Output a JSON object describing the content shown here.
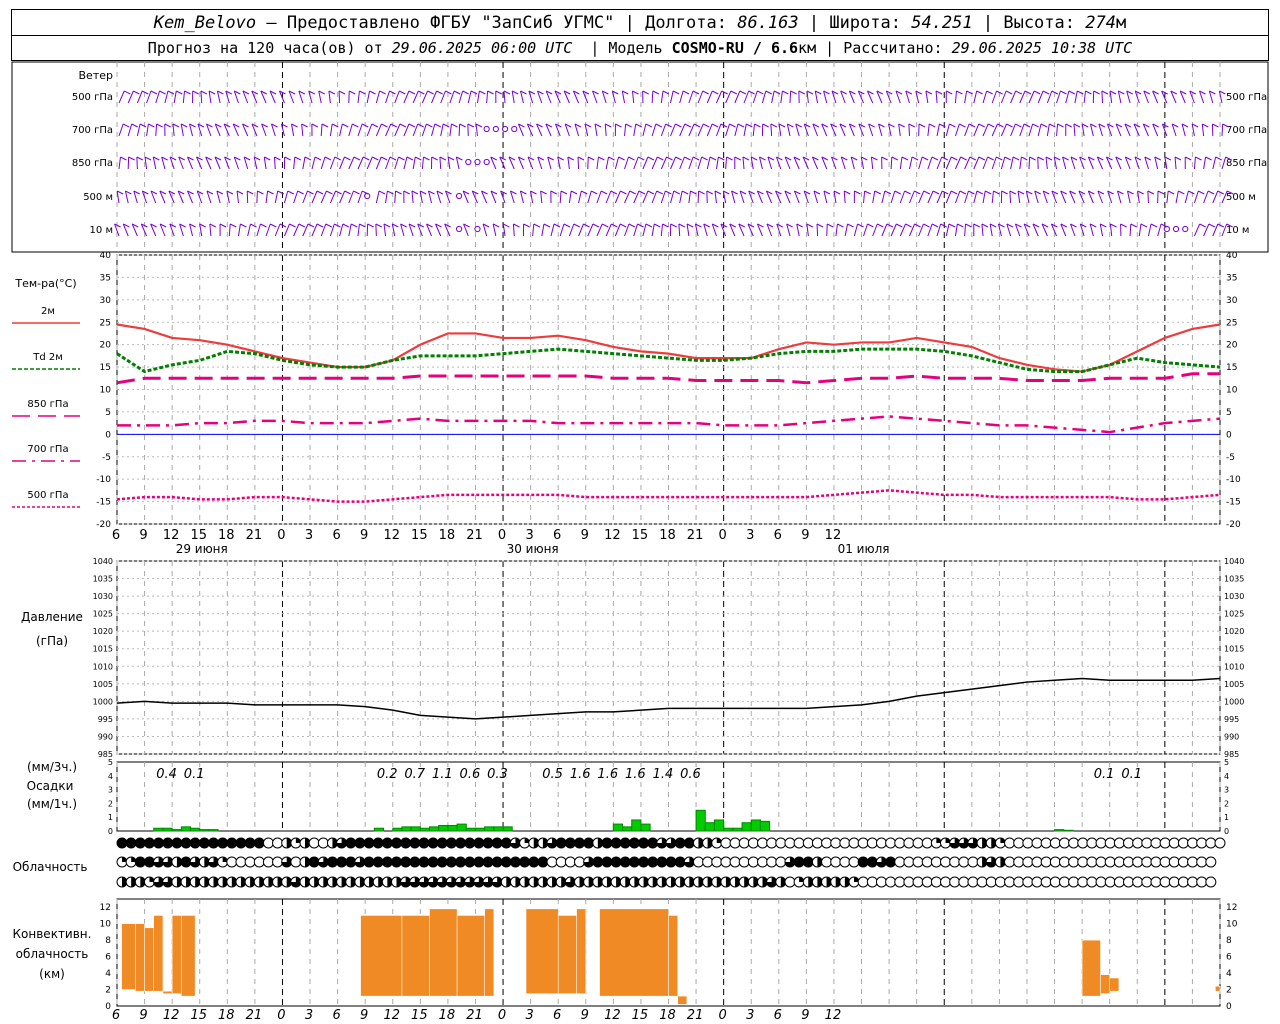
{
  "header": {
    "station": "Kem_Belovo",
    "sep1": " – Предоставлено ",
    "provider": "ФГБУ \"ЗапСиб УГМС\"",
    "lon_label": " | Долгота: ",
    "lon": "86.163",
    "lat_label": " | Широта: ",
    "lat": "54.251",
    "alt_label": " | Высота: ",
    "alt": "274",
    "alt_unit": "м",
    "forecast_label": "Прогноз на 120 часа(ов) от ",
    "forecast_time": "29.06.2025 06:00 UTC",
    "model_label": "  | Модель ",
    "model": "COSMO-RU / 6.6",
    "model_unit": "км",
    "calc_label": " | Рассчитано: ",
    "calc_time": "29.06.2025 10:38 UTC"
  },
  "colors": {
    "t2m": "#ee3b3b",
    "td2m": "#008000",
    "t850": "#e6007e",
    "t700": "#e6007e",
    "t500": "#e6007e",
    "wind": "#7a00d6",
    "precip": "#00cc00",
    "convective": "#f08a24",
    "pressure": "#000000",
    "zero_line": "#0000ff"
  },
  "axis": {
    "hour_ticks": [
      "6",
      "9",
      "12",
      "15",
      "18",
      "21",
      "0",
      "3",
      "6",
      "9",
      "12",
      "15",
      "18",
      "21",
      "0",
      "3",
      "6",
      "9",
      "12",
      "15",
      "18",
      "21",
      "0",
      "3",
      "6",
      "9",
      "12"
    ],
    "dates": [
      "29 июня",
      "30 июня",
      "01 июля"
    ]
  },
  "wind": {
    "title": "Ветер",
    "levels": [
      "500 гПа",
      "700 гПа",
      "850 гПа",
      "500 м",
      "10 м"
    ]
  },
  "chart_data": [
    {
      "type": "line",
      "title": "Тем-ра(°C)",
      "ylim": [
        -20,
        40
      ],
      "y_ticks": [
        "40",
        "35",
        "30",
        "25",
        "20",
        "15",
        "10",
        "5",
        "0",
        "-5",
        "-10",
        "-15",
        "-20"
      ],
      "x_hours_from_start": [
        0,
        3,
        6,
        9,
        12,
        15,
        18,
        21,
        24,
        27,
        30,
        33,
        36,
        39,
        42,
        45,
        48,
        51,
        54,
        57,
        60,
        63,
        66,
        69,
        72,
        75,
        78,
        81,
        84,
        87,
        90,
        93,
        96,
        99,
        102,
        105,
        108,
        111,
        114,
        117,
        120
      ],
      "series": [
        {
          "name": "2м",
          "values": [
            24.5,
            23.5,
            21.5,
            21,
            20,
            18.5,
            17,
            16,
            15,
            15,
            16.5,
            20,
            22.5,
            22.5,
            21.5,
            21.5,
            22,
            21,
            19.5,
            18.5,
            18,
            17,
            17,
            17,
            19,
            20.5,
            20,
            20.5,
            20.5,
            21.5,
            20.5,
            19.5,
            17,
            15.5,
            14.5,
            14,
            15.5,
            18.5,
            21.5,
            23.5,
            24.5
          ]
        },
        {
          "name": "Td 2м",
          "values": [
            18,
            14,
            15.5,
            16.5,
            18.5,
            18,
            16.5,
            15.5,
            15,
            15,
            16.5,
            17.5,
            17.5,
            17.5,
            18,
            18.5,
            19,
            18.5,
            18,
            17.5,
            17,
            16.5,
            16.5,
            17,
            18,
            18.5,
            18.5,
            19,
            19,
            19,
            18.5,
            17.5,
            16,
            14.5,
            14,
            14,
            15.5,
            17,
            16,
            15.5,
            15
          ]
        },
        {
          "name": "850 гПа",
          "values": [
            11.5,
            12.5,
            12.5,
            12.5,
            12.5,
            12.5,
            12.5,
            12.5,
            12.5,
            12.5,
            12.5,
            13,
            13,
            13,
            13,
            13,
            13,
            13,
            12.5,
            12.5,
            12.5,
            12,
            12,
            12,
            12,
            11.5,
            12,
            12.5,
            12.5,
            13,
            12.5,
            12.5,
            12.5,
            12,
            12,
            12,
            12.5,
            12.5,
            12.5,
            13.5,
            13.5
          ]
        },
        {
          "name": "700 гПа",
          "values": [
            2,
            2,
            2,
            2.5,
            2.5,
            3,
            3,
            2.5,
            2.5,
            2.5,
            3,
            3.5,
            3,
            3,
            3,
            3,
            2.5,
            2.5,
            2.5,
            2.5,
            2.5,
            2.5,
            2,
            2,
            2,
            2.5,
            3,
            3.5,
            4,
            3.5,
            3,
            2.5,
            2,
            2,
            1.5,
            1,
            0.5,
            1.5,
            2.5,
            3,
            3.5
          ]
        },
        {
          "name": "500 гПа",
          "values": [
            -14.5,
            -14,
            -14,
            -14.5,
            -14.5,
            -14,
            -14,
            -14.5,
            -15,
            -15,
            -14.5,
            -14,
            -13.5,
            -13.5,
            -13.5,
            -13.5,
            -13.5,
            -14,
            -14,
            -14,
            -14,
            -14,
            -14,
            -14,
            -14,
            -14,
            -13.5,
            -13,
            -12.5,
            -13,
            -13.5,
            -13.5,
            -14,
            -14,
            -14,
            -14,
            -14,
            -14.5,
            -14.5,
            -14,
            -13.5
          ]
        }
      ]
    },
    {
      "type": "line",
      "title": "Давление",
      "ylabel": "(гПа)",
      "ylim": [
        985,
        1040
      ],
      "y_ticks": [
        "1040",
        "1035",
        "1030",
        "1025",
        "1020",
        "1015",
        "1010",
        "1005",
        "1000",
        "995",
        "990",
        "985"
      ],
      "x_hours_from_start": [
        0,
        3,
        6,
        9,
        12,
        15,
        18,
        21,
        24,
        27,
        30,
        33,
        36,
        39,
        42,
        45,
        48,
        51,
        54,
        57,
        60,
        63,
        66,
        69,
        72,
        75,
        78,
        81,
        84,
        87,
        90,
        93,
        96,
        99,
        102,
        105,
        108,
        111,
        114,
        117,
        120
      ],
      "series": [
        {
          "name": "Давление",
          "values": [
            999.5,
            1000,
            999.5,
            999.5,
            999.5,
            999,
            999,
            999,
            999,
            998.5,
            997.5,
            996,
            995.5,
            995,
            995.5,
            996,
            996.5,
            997,
            997,
            997.5,
            998,
            998,
            998,
            998,
            998,
            998,
            998.5,
            999,
            1000,
            1001.5,
            1002.5,
            1003.5,
            1004.5,
            1005.5,
            1006,
            1006.5,
            1006,
            1006,
            1006,
            1006,
            1006.5
          ]
        }
      ]
    },
    {
      "type": "bar",
      "title": "Осадки",
      "ylabel": "(мм/3ч.) (мм/1ч.)",
      "ylim": [
        0,
        5
      ],
      "y_ticks": [
        "5",
        "4",
        "3",
        "2",
        "1",
        "0"
      ],
      "x_hours_from_start": [
        3,
        6,
        9,
        12,
        15,
        18,
        21,
        24,
        27,
        30,
        33,
        36,
        39,
        42,
        45,
        48,
        51,
        54,
        57,
        60,
        63,
        66,
        69,
        72,
        75,
        78,
        81,
        84,
        87,
        90,
        93,
        96,
        99,
        102,
        105,
        108,
        111,
        114,
        117,
        120
      ],
      "totals_3h": [
        {
          "hour": 3,
          "value": "0.4"
        },
        {
          "hour": 6,
          "value": "0.1"
        },
        {
          "hour": 27,
          "value": "0.2"
        },
        {
          "hour": 30,
          "value": "0.7"
        },
        {
          "hour": 33,
          "value": "1.1"
        },
        {
          "hour": 36,
          "value": "0.6"
        },
        {
          "hour": 39,
          "value": "0.3"
        },
        {
          "hour": 45,
          "value": "0.5"
        },
        {
          "hour": 48,
          "value": "1.6"
        },
        {
          "hour": 51,
          "value": "1.6"
        },
        {
          "hour": 54,
          "value": "1.6"
        },
        {
          "hour": 57,
          "value": "1.4"
        },
        {
          "hour": 60,
          "value": "0.6"
        },
        {
          "hour": 105,
          "value": "0.1"
        },
        {
          "hour": 108,
          "value": "0.1"
        }
      ],
      "hourly": [
        0,
        0,
        0,
        0,
        0.2,
        0.2,
        0.1,
        0.3,
        0.2,
        0.1,
        0.1,
        0,
        0,
        0,
        0,
        0,
        0,
        0,
        0,
        0,
        0,
        0,
        0,
        0,
        0,
        0,
        0,
        0,
        0.2,
        0,
        0.2,
        0.3,
        0.3,
        0.2,
        0.3,
        0.4,
        0.4,
        0.5,
        0.2,
        0.2,
        0.3,
        0.3,
        0.3,
        0,
        0,
        0,
        0,
        0,
        0,
        0,
        0,
        0,
        0,
        0,
        0.5,
        0.3,
        0.8,
        0.5,
        0,
        0,
        0,
        0,
        0,
        1.5,
        0.6,
        0.8,
        0.2,
        0.2,
        0.6,
        0.8,
        0.7,
        0,
        0,
        0,
        0,
        0,
        0,
        0,
        0,
        0,
        0,
        0,
        0,
        0,
        0,
        0,
        0,
        0,
        0,
        0,
        0,
        0,
        0,
        0,
        0,
        0,
        0,
        0,
        0,
        0,
        0,
        0,
        0.1,
        0.05,
        0,
        0,
        0,
        0,
        0,
        0,
        0,
        0,
        0,
        0,
        0,
        0,
        0
      ]
    },
    {
      "type": "table",
      "title": "Облачность",
      "rows_octas_by_level": [
        [
          8,
          8,
          8,
          8,
          8,
          8,
          8,
          8,
          8,
          8,
          8,
          8,
          8,
          8,
          8,
          8,
          0,
          0,
          4,
          2,
          4,
          0,
          0,
          4,
          6,
          8,
          8,
          8,
          8,
          8,
          8,
          8,
          8,
          8,
          8,
          8,
          8,
          8,
          8,
          8,
          8,
          8,
          8,
          6,
          2,
          4,
          4,
          6,
          8,
          8,
          8,
          8,
          4,
          8,
          8,
          8,
          8,
          8,
          8,
          6,
          6,
          8,
          8,
          4,
          4,
          2,
          0,
          0,
          0,
          0,
          0,
          0,
          0,
          0,
          0,
          0,
          0,
          0,
          0,
          0,
          0,
          0,
          0,
          0,
          0,
          0,
          0,
          0,
          0,
          2,
          2,
          6,
          6,
          6,
          4,
          4,
          2,
          0,
          0,
          0,
          0,
          0,
          0,
          0,
          0,
          0,
          0,
          0,
          0,
          0,
          0,
          0,
          0,
          0,
          0,
          0,
          0,
          0,
          0,
          0,
          0
        ],
        [
          2,
          2,
          8,
          8,
          6,
          6,
          4,
          8,
          6,
          4,
          6,
          2,
          0,
          0,
          0,
          0,
          0,
          0,
          6,
          0,
          4,
          8,
          6,
          8,
          8,
          8,
          6,
          8,
          8,
          8,
          8,
          8,
          8,
          8,
          8,
          8,
          8,
          8,
          8,
          8,
          8,
          8,
          8,
          8,
          8,
          8,
          8,
          0,
          0,
          0,
          0,
          6,
          8,
          8,
          8,
          8,
          8,
          8,
          8,
          8,
          8,
          8,
          6,
          0,
          0,
          0,
          0,
          0,
          0,
          0,
          0,
          0,
          0,
          6,
          8,
          8,
          4,
          0,
          0,
          0,
          0,
          8,
          8,
          6,
          8,
          0,
          0,
          0,
          0,
          0,
          0,
          0,
          0,
          0,
          4,
          6,
          4,
          0,
          0,
          0,
          0,
          0,
          0,
          0,
          0,
          0,
          0,
          0,
          0,
          0,
          0,
          0,
          0,
          0,
          0,
          0,
          0,
          0,
          0,
          0
        ],
        [
          4,
          4,
          4,
          2,
          6,
          6,
          4,
          4,
          4,
          4,
          4,
          4,
          4,
          4,
          4,
          4,
          4,
          4,
          4,
          6,
          4,
          4,
          4,
          4,
          4,
          4,
          4,
          4,
          4,
          4,
          4,
          6,
          6,
          6,
          6,
          6,
          6,
          6,
          6,
          6,
          6,
          6,
          4,
          4,
          4,
          4,
          4,
          4,
          4,
          6,
          4,
          4,
          4,
          4,
          4,
          4,
          4,
          4,
          4,
          4,
          4,
          4,
          4,
          4,
          4,
          4,
          4,
          4,
          4,
          4,
          4,
          6,
          4,
          0,
          2,
          4,
          4,
          4,
          4,
          4,
          2,
          0,
          0,
          0,
          0,
          0,
          0,
          0,
          0,
          0,
          0,
          0,
          0,
          0,
          0,
          0,
          0,
          0,
          0,
          0,
          0,
          0,
          0,
          0,
          0,
          0,
          0,
          0,
          0,
          0,
          0,
          0,
          0,
          0,
          0,
          0,
          0,
          0,
          0,
          0
        ]
      ]
    },
    {
      "type": "bar",
      "title": "Конвективн. облачность",
      "ylabel": "(км)",
      "ylim": [
        0,
        13
      ],
      "y_ticks": [
        "12",
        "10",
        "8",
        "6",
        "4",
        "2",
        "0"
      ],
      "layers": [
        {
          "from_hour": 0.5,
          "to_hour": 2,
          "base": 2,
          "top": 10
        },
        {
          "from_hour": 2,
          "to_hour": 3,
          "base": 1.8,
          "top": 10
        },
        {
          "from_hour": 3,
          "to_hour": 4,
          "base": 1.8,
          "top": 9.5
        },
        {
          "from_hour": 4,
          "to_hour": 5,
          "base": 1.8,
          "top": 11
        },
        {
          "from_hour": 5,
          "to_hour": 6,
          "base": 1.5,
          "top": 1.8
        },
        {
          "from_hour": 6,
          "to_hour": 7,
          "base": 1.5,
          "top": 11
        },
        {
          "from_hour": 7,
          "to_hour": 8.5,
          "base": 1.2,
          "top": 11
        },
        {
          "from_hour": 26.5,
          "to_hour": 31,
          "base": 1.2,
          "top": 11
        },
        {
          "from_hour": 31,
          "to_hour": 34,
          "base": 1.2,
          "top": 11
        },
        {
          "from_hour": 34,
          "to_hour": 37,
          "base": 1.2,
          "top": 11.8
        },
        {
          "from_hour": 37,
          "to_hour": 40,
          "base": 1.2,
          "top": 11
        },
        {
          "from_hour": 40,
          "to_hour": 41,
          "base": 1.2,
          "top": 11.8
        },
        {
          "from_hour": 44.5,
          "to_hour": 48,
          "base": 1.5,
          "top": 11.8
        },
        {
          "from_hour": 48,
          "to_hour": 50,
          "base": 1.5,
          "top": 11
        },
        {
          "from_hour": 50,
          "to_hour": 51,
          "base": 1.5,
          "top": 11.8
        },
        {
          "from_hour": 52.5,
          "to_hour": 60,
          "base": 1.2,
          "top": 11.8
        },
        {
          "from_hour": 60,
          "to_hour": 61,
          "base": 1.2,
          "top": 11
        },
        {
          "from_hour": 61,
          "to_hour": 62,
          "base": 0.2,
          "top": 1.2
        },
        {
          "from_hour": 105,
          "to_hour": 107,
          "base": 1.2,
          "top": 8
        },
        {
          "from_hour": 107,
          "to_hour": 108,
          "base": 1.5,
          "top": 3.8
        },
        {
          "from_hour": 108,
          "to_hour": 109,
          "base": 1.8,
          "top": 3.4
        },
        {
          "from_hour": 119.5,
          "to_hour": 120,
          "base": 1.8,
          "top": 2.4
        }
      ]
    }
  ]
}
